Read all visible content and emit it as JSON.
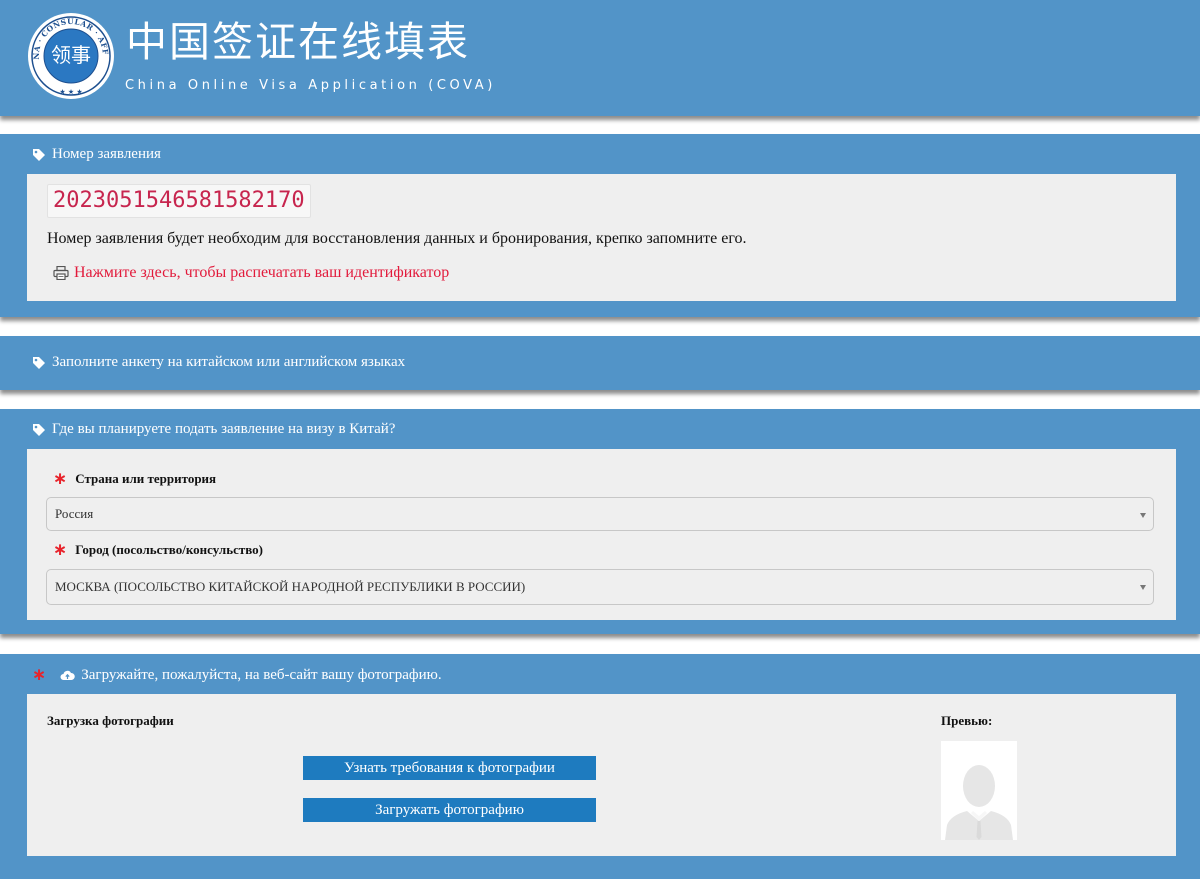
{
  "header": {
    "logo_text": "CHINA · CONSULAR · AFFAIRS",
    "title_cn": "中国签证在线填表",
    "title_en": "China Online Visa Application (COVA)"
  },
  "application_number": {
    "heading": "Номер заявления",
    "number": "2023051546581582170",
    "note": "Номер заявления будет необходим для восстановления данных и бронирования, крепко запомните его.",
    "print_link": "Нажмите здесь, чтобы распечатать ваш идентификатор"
  },
  "language_notice": {
    "heading": "Заполните анкету на китайском или английском языках"
  },
  "location": {
    "heading": "Где вы планируете подать заявление на визу в Китай?",
    "country_label": "Страна или территория",
    "country_value": "Россия",
    "city_label": "Город (посольство/консульство)",
    "city_value": "МОСКВА (ПОСОЛЬСТВО КИТАЙСКОЙ НАРОДНОЙ РЕСПУБЛИКИ В РОССИИ)"
  },
  "photo": {
    "heading": "Загружайте, пожалуйста, на веб-сайт вашу фотографию.",
    "upload_label": "Загрузка фотографии",
    "preview_label": "Превью:",
    "requirements_button": "Узнать требования к фотографии",
    "upload_button": "Загружать фотографию"
  },
  "required_mark": "∗",
  "colors": {
    "header_bg": "#5294c8",
    "panel_body": "#efefef",
    "button": "#1e7bbf",
    "required": "#e8232b",
    "link": "#e21a3b",
    "id_text": "#c7254e"
  }
}
